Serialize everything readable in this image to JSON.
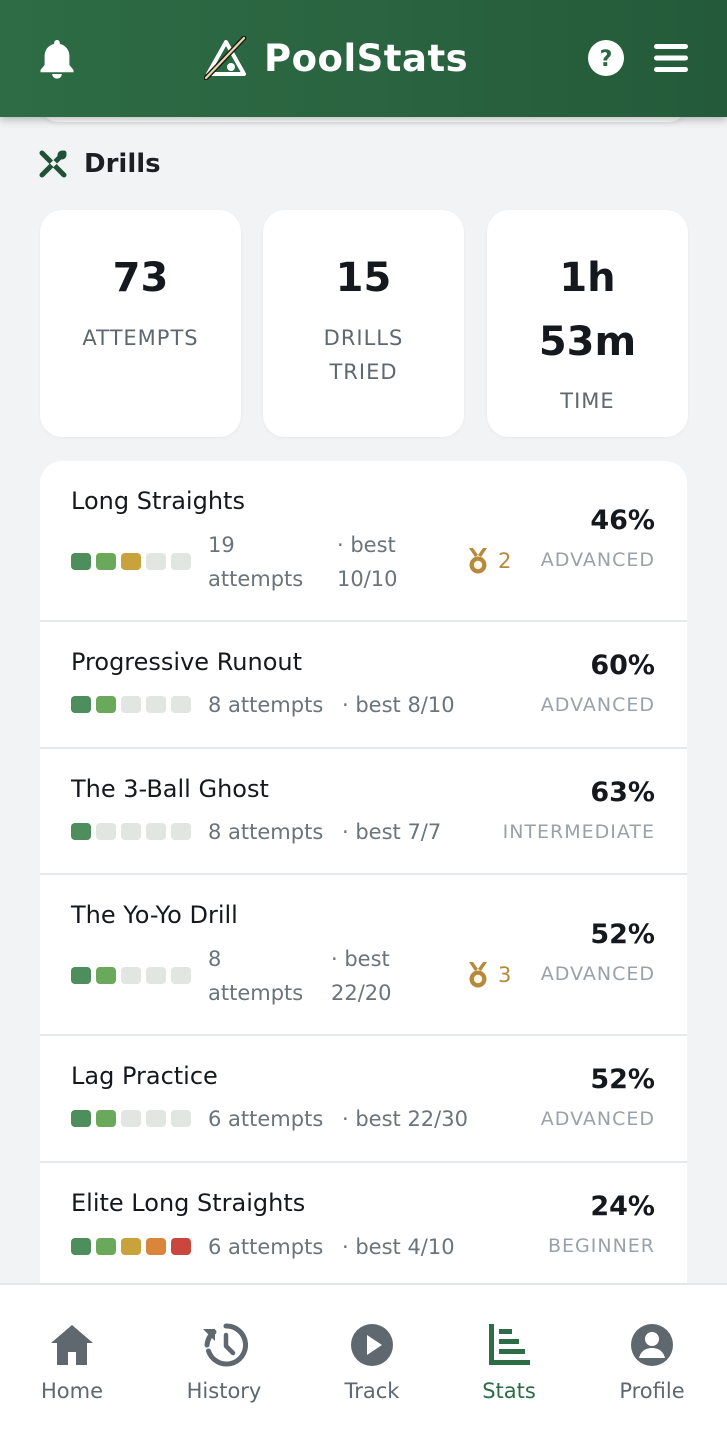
{
  "header": {
    "app_name": "PoolStats",
    "bell_icon": "bell-icon",
    "help_icon": "help-circle-icon",
    "menu_icon": "hamburger-menu-icon",
    "background_color": "#2b6842"
  },
  "section": {
    "title": "Drills",
    "icon": "crossed-cues-icon"
  },
  "stats": {
    "attempts": {
      "value": "73",
      "label": "ATTEMPTS"
    },
    "drills_tried": {
      "value": "15",
      "label_line1": "DRILLS",
      "label_line2": "TRIED"
    },
    "time": {
      "value_line1": "1h",
      "value_line2": "53m",
      "label": "TIME"
    }
  },
  "drills": [
    {
      "name": "Long Straights",
      "attempts_line1": "19",
      "attempts_line2": "attempts",
      "best_line1": "· best",
      "best_line2": "10/10",
      "medal_count": "2",
      "percent": "46%",
      "level": "ADVANCED",
      "pips": [
        "#4e8d5c",
        "#6aa85a",
        "#c9a23c",
        "#e1e6e3",
        "#e1e6e3"
      ]
    },
    {
      "name": "Progressive Runout",
      "attempts": "8 attempts",
      "best": "· best 8/10",
      "percent": "60%",
      "level": "ADVANCED",
      "pips": [
        "#4e8d5c",
        "#6aa85a",
        "#e1e6e3",
        "#e1e6e3",
        "#e1e6e3"
      ]
    },
    {
      "name": "The 3-Ball Ghost",
      "attempts": "8 attempts",
      "best": "· best 7/7",
      "percent": "63%",
      "level": "INTERMEDIATE",
      "pips": [
        "#4e8d5c",
        "#e1e6e3",
        "#e1e6e3",
        "#e1e6e3",
        "#e1e6e3"
      ]
    },
    {
      "name": "The Yo-Yo Drill",
      "attempts_line1": "8",
      "attempts_line2": "attempts",
      "best_line1": "· best",
      "best_line2": "22/20",
      "medal_count": "3",
      "percent": "52%",
      "level": "ADVANCED",
      "pips": [
        "#4e8d5c",
        "#6aa85a",
        "#e1e6e3",
        "#e1e6e3",
        "#e1e6e3"
      ]
    },
    {
      "name": "Lag Practice",
      "attempts": "6 attempts",
      "best": "· best 22/30",
      "percent": "52%",
      "level": "ADVANCED",
      "pips": [
        "#4e8d5c",
        "#6aa85a",
        "#e1e6e3",
        "#e1e6e3",
        "#e1e6e3"
      ]
    },
    {
      "name": "Elite Long Straights",
      "attempts": "6 attempts",
      "best": "· best 4/10",
      "percent": "24%",
      "level": "BEGINNER",
      "pips": [
        "#4e8d5c",
        "#6aa85a",
        "#c9a23c",
        "#d9853a",
        "#c9473c"
      ]
    }
  ],
  "nav": {
    "items": [
      {
        "label": "Home",
        "icon": "home-icon"
      },
      {
        "label": "History",
        "icon": "history-icon"
      },
      {
        "label": "Track",
        "icon": "play-circle-icon"
      },
      {
        "label": "Stats",
        "icon": "bar-chart-icon"
      },
      {
        "label": "Profile",
        "icon": "user-circle-icon"
      }
    ],
    "active": "Stats",
    "active_color": "#2d6c45"
  }
}
